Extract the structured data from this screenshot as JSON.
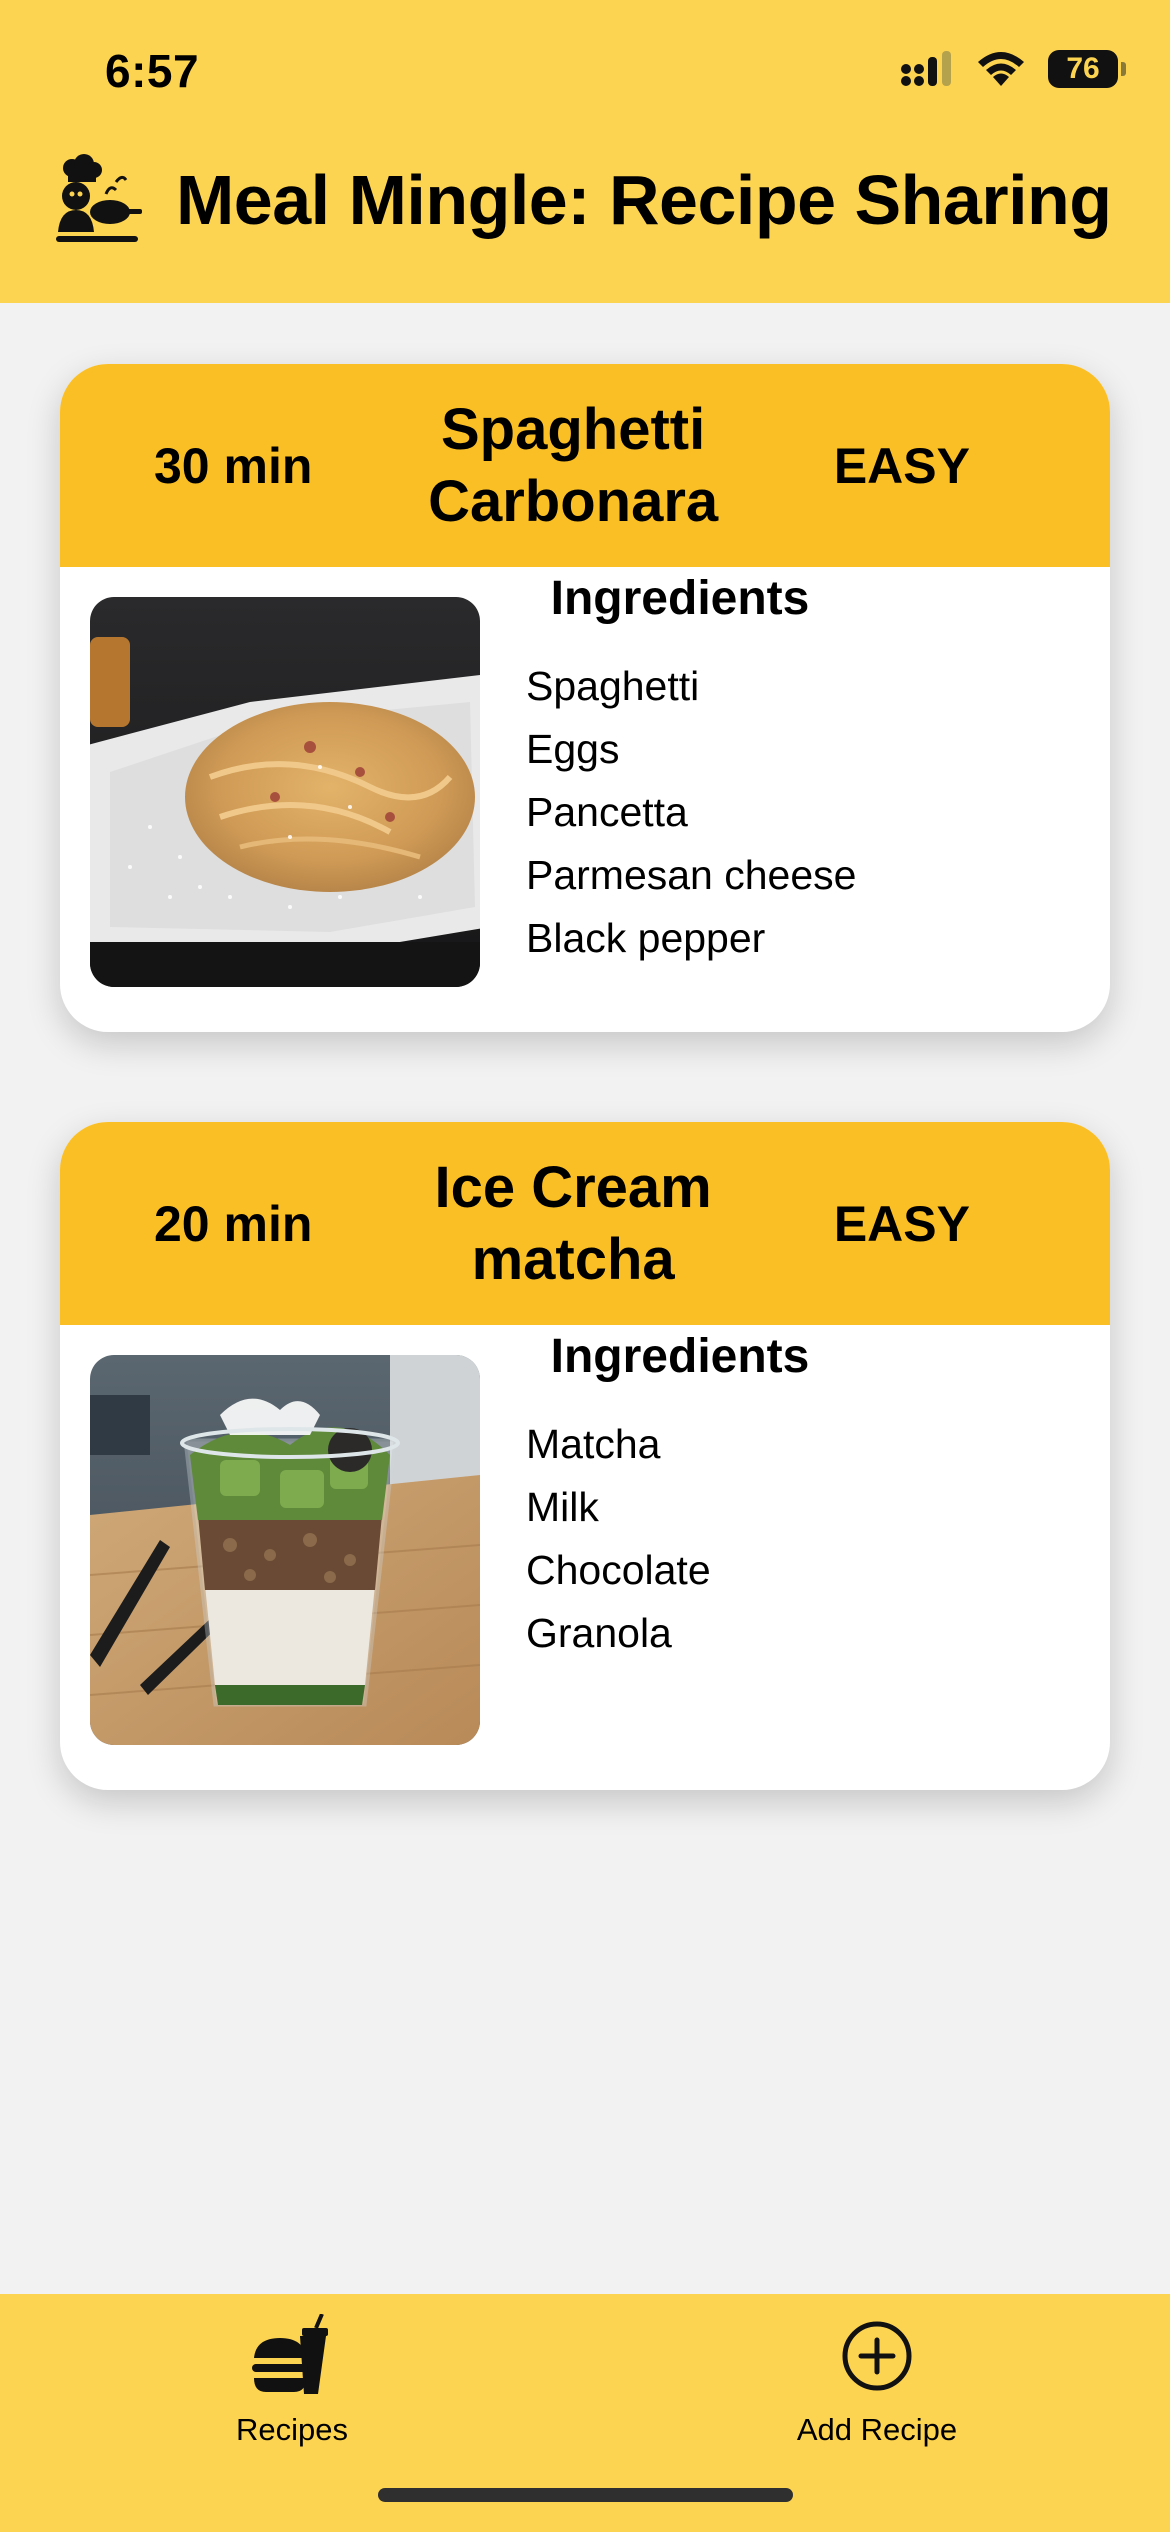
{
  "status_bar": {
    "time": "6:57",
    "battery": "76"
  },
  "header": {
    "title": "Meal Mingle: Recipe Sharing"
  },
  "recipes": [
    {
      "time": "30 min",
      "name": "Spaghetti Carbonara",
      "difficulty": "EASY",
      "ingredients_title": "Ingredients",
      "ingredients": [
        "Spaghetti",
        "Eggs",
        "Pancetta",
        "Parmesan cheese",
        "Black pepper"
      ]
    },
    {
      "time": "20 min",
      "name": "Ice Cream matcha",
      "difficulty": "EASY",
      "ingredients_title": "Ingredients",
      "ingredients": [
        "Matcha",
        "Milk",
        "Chocolate",
        "Granola"
      ]
    }
  ],
  "tabbar": {
    "recipes_label": "Recipes",
    "add_label": "Add Recipe"
  },
  "colors": {
    "header_bg": "#fdd452",
    "card_header_bg": "#fbbf26",
    "page_bg": "#f2f2f2"
  },
  "icons": {
    "header": "chef-icon",
    "recipes_tab": "fast-food-icon",
    "add_tab": "plus-circle-icon"
  }
}
